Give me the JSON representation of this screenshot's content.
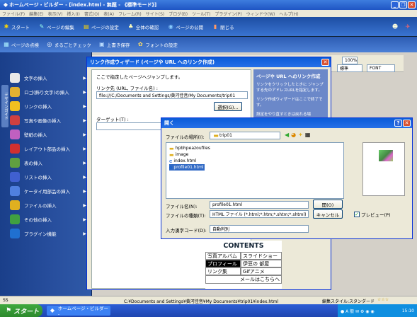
{
  "window": {
    "title": "ホームページ・ビルダー - [index.html - 無題 - 《標準モード》]"
  },
  "menu": [
    "ファイル(F)",
    "編集(E)",
    "表示(V)",
    "挿入(I)",
    "書式(O)",
    "表(A)",
    "フレーム(R)",
    "サイト(S)",
    "ブログ(B)",
    "ツール(T)",
    "プラグイン(P)",
    "ウィンドウ(W)",
    "ヘルプ(H)"
  ],
  "toolbar1": {
    "start": "スタート",
    "page_edit": "ページの編集",
    "page_settings": "ページの設定",
    "check": "全体の確認",
    "publish": "ページの公開",
    "close": "閉じる"
  },
  "toolbar2": {
    "page_check": "ページの点検",
    "batch_check": "まるごとチェック",
    "overwrite_save": "上書き保存",
    "font_settings": "フォントの設定"
  },
  "format_toolbar": {
    "style": "標準",
    "zoom": "100%",
    "style2": "標準",
    "font": "FONT"
  },
  "sidebar": {
    "vertical_tab": "デザインガイド",
    "items": [
      {
        "label": "文字の挿入",
        "icon": "text-icon",
        "color": "#e8e8e8"
      },
      {
        "label": "ロゴ(飾り文字)の挿入",
        "icon": "logo-icon",
        "color": "#e0b030"
      },
      {
        "label": "リンクの挿入",
        "icon": "link-icon",
        "color": "#f0c020"
      },
      {
        "label": "写真や画像の挿入",
        "icon": "image-icon",
        "color": "#d04040"
      },
      {
        "label": "壁紙の挿入",
        "icon": "wallpaper-icon",
        "color": "#c060c0"
      },
      {
        "label": "レイアウト部品の挿入",
        "icon": "layout-icon",
        "color": "#d03030"
      },
      {
        "label": "表の挿入",
        "icon": "table-icon",
        "color": "#60a040"
      },
      {
        "label": "リストの挿入",
        "icon": "list-icon",
        "color": "#4060d0"
      },
      {
        "label": "ケータイ用部品の挿入",
        "icon": "mobile-icon",
        "color": "#5080e0"
      },
      {
        "label": "ファイルの挿入",
        "icon": "folder-icon",
        "color": "#e0b020"
      },
      {
        "label": "その他の挿入",
        "icon": "other-icon",
        "color": "#40a040"
      },
      {
        "label": "プラグイン機能",
        "icon": "plugin-icon",
        "color": "#2070d0"
      }
    ]
  },
  "wizard": {
    "title": "リンク作成ウィザード (ページや URL へのリンク作成)",
    "instruction": "ここで指定したページへジャンプします。",
    "link_label": "リンク先 (URL, ファイル名) :",
    "link_value": "file:///C:/Documents and Settings/黄河佳音/My Documents/trip01",
    "browse_button": "選択(G)...",
    "target_label": "ターゲット(T) :",
    "help_title": "ページや URL へのリンク作成",
    "help_text": "リンクをクリックしたときに ジャンプする先のアドレスURLを指定します。",
    "help_text2": "リンク作成ウィザードはここで終了です。",
    "help_text3": "設定をやり直すときは戻れる場"
  },
  "open_dialog": {
    "title": "開く",
    "location_label": "ファイルの場所(I):",
    "location_value": "trip01",
    "files": [
      {
        "name": "hpbhpeazoufiles",
        "type": "folder"
      },
      {
        "name": "image",
        "type": "folder"
      },
      {
        "name": "index.html",
        "type": "html"
      },
      {
        "name": "profile01.html",
        "type": "html",
        "selected": true
      }
    ],
    "filename_label": "ファイル名(N):",
    "filename_value": "profile01.html",
    "filetype_label": "ファイルの種類(T):",
    "filetype_value": "HTML ファイル (*.html;*.htm;*.shtm;*.shtml)",
    "encoding_label": "入力漢字コード(D):",
    "encoding_value": "自動判別",
    "open_button": "開(O)",
    "cancel_button": "キャンセル",
    "preview_label": "プレビュー(P)",
    "preview_checked": true
  },
  "contents": {
    "title": "CONTENTS",
    "cells": [
      "写真アルバム",
      "スライドショー",
      "プロフィール",
      "伊豆の 部屋",
      "リンク集",
      "Gifアニメ",
      "メールはこちらへ"
    ]
  },
  "statusbar": {
    "path": "C:¥Documents and Settings¥黄河佳音¥My Documents¥trip01¥index.html",
    "style": "編集スタイル:スタンダード",
    "stars": "☆☆☆",
    "time": "15:10"
  },
  "taskbar": {
    "start": "スタート",
    "app": "ホームページ・ビルダー -"
  }
}
